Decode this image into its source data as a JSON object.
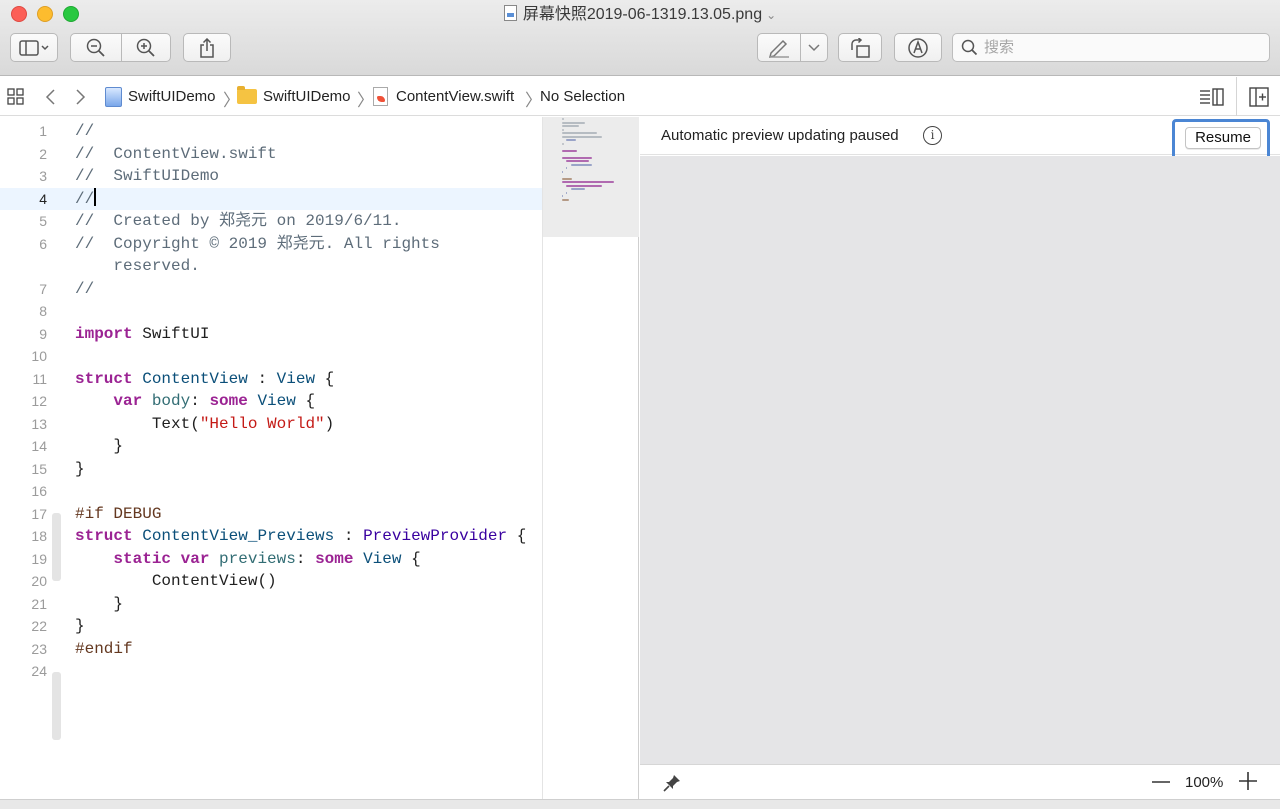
{
  "window": {
    "title": "屏幕快照2019-06-1319.13.05.png",
    "title_icon": "png-document-icon"
  },
  "toolbar": {
    "search_placeholder": "搜索"
  },
  "jumpbar": {
    "project": "SwiftUIDemo",
    "folder": "SwiftUIDemo",
    "file": "ContentView.swift",
    "selection": "No Selection"
  },
  "editor": {
    "current_line": 4,
    "lines": [
      {
        "n": "1",
        "t": "//"
      },
      {
        "n": "2",
        "t": "//  ContentView.swift"
      },
      {
        "n": "3",
        "t": "//  SwiftUIDemo"
      },
      {
        "n": "4",
        "t": "//"
      },
      {
        "n": "5",
        "t": "//  Created by 郑尧元 on 2019/6/11."
      },
      {
        "n": "6",
        "t": "//  Copyright © 2019 郑尧元. All rights"
      },
      {
        "n": "",
        "t": "    reserved."
      },
      {
        "n": "7",
        "t": "//"
      },
      {
        "n": "8",
        "t": ""
      },
      {
        "n": "9",
        "t": "import SwiftUI"
      },
      {
        "n": "10",
        "t": ""
      },
      {
        "n": "11",
        "t": "struct ContentView : View {"
      },
      {
        "n": "12",
        "t": "    var body: some View {"
      },
      {
        "n": "13",
        "t": "        Text(\"Hello World\")"
      },
      {
        "n": "14",
        "t": "    }"
      },
      {
        "n": "15",
        "t": "}"
      },
      {
        "n": "16",
        "t": ""
      },
      {
        "n": "17",
        "t": "#if DEBUG"
      },
      {
        "n": "18",
        "t": "struct ContentView_Previews : PreviewProvider {"
      },
      {
        "n": "19",
        "t": "    static var previews: some View {"
      },
      {
        "n": "20",
        "t": "        ContentView()"
      },
      {
        "n": "21",
        "t": "    }"
      },
      {
        "n": "22",
        "t": "}"
      },
      {
        "n": "23",
        "t": "#endif"
      },
      {
        "n": "24",
        "t": ""
      }
    ]
  },
  "canvas": {
    "status_message": "Automatic preview updating paused",
    "resume_label": "Resume",
    "zoom": "100%"
  },
  "colors": {
    "keyword": "#9b2393",
    "comment": "#5d6c79",
    "string": "#c41a16",
    "highlight_border": "#4b86d4",
    "canvas_bg": "#e5e5e7"
  }
}
